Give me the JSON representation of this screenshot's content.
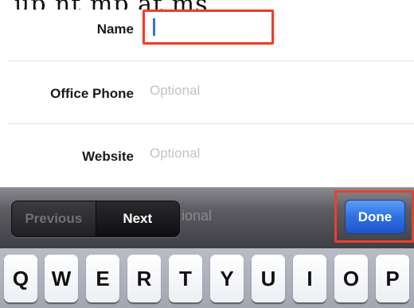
{
  "clipped_text": "up  nt  mp  at ms ",
  "form": {
    "name": {
      "label": "Name",
      "value": ""
    },
    "office_phone": {
      "label": "Office Phone",
      "placeholder": "Optional"
    },
    "website": {
      "label": "Website",
      "placeholder": "Optional"
    },
    "hidden_field_placeholder": "ional"
  },
  "toolbar": {
    "previous_label": "Previous",
    "next_label": "Next",
    "done_label": "Done"
  },
  "keyboard": {
    "keys": [
      "Q",
      "W",
      "E",
      "R",
      "T",
      "Y",
      "U",
      "I",
      "O",
      "P"
    ]
  },
  "colors": {
    "highlight": "#e8412b",
    "done_button": "#2f6fe3",
    "caret": "#3a6fe0"
  }
}
